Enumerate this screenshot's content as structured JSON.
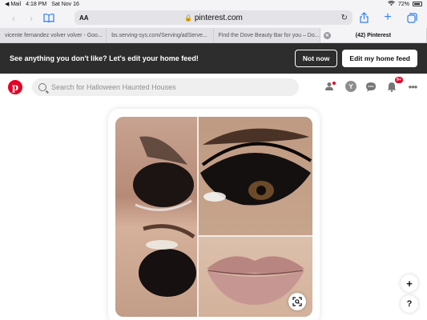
{
  "status_bar": {
    "back_app": "◀ Mail",
    "time": "4:18 PM",
    "date": "Sat Nov 16",
    "battery": "72%"
  },
  "browser": {
    "text_size_label": "AA",
    "url": "pinterest.com",
    "tabs": [
      {
        "title": "vicente fernandez volver volver - Goo..."
      },
      {
        "title": "bs.serving-sys.com/Serving/adServe..."
      },
      {
        "title": "Find the Dove Beauty Bar for you – Do..."
      },
      {
        "title": "(42) Pinterest"
      }
    ]
  },
  "banner": {
    "message": "See anything you don't like? Let's edit your home feed!",
    "not_now": "Not now",
    "edit_feed": "Edit my home feed"
  },
  "pinterest": {
    "logo_letter": "p",
    "search_placeholder": "Search for Halloween Haunted Houses",
    "avatar_letter": "Y",
    "notification_badge": "9+"
  },
  "floating": {
    "add": "+",
    "help": "?"
  },
  "colors": {
    "brand": "#e60023",
    "banner_bg": "#2d2d2d",
    "safari_blue": "#2f7cf6"
  }
}
